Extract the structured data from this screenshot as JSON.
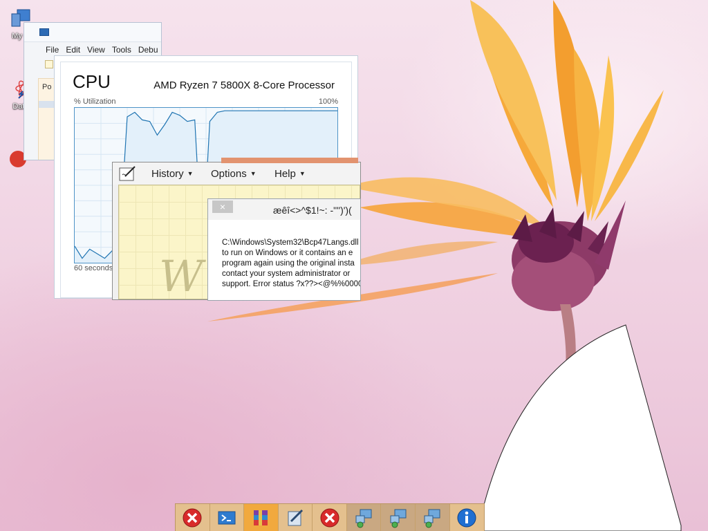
{
  "desktop": {
    "icons": [
      {
        "label": "My C"
      },
      {
        "label": "Data"
      }
    ]
  },
  "back_window": {
    "menu": [
      "File",
      "Edit",
      "View",
      "Tools",
      "Debu"
    ],
    "tab_label": "Po"
  },
  "cpu_window": {
    "title": "CPU",
    "model": "AMD Ryzen 7 5800X 8-Core Processor",
    "util_label": "% Utilization",
    "max_label": "100%",
    "time_label": "60 seconds",
    "utilization_series": [
      10,
      2,
      8,
      5,
      2,
      7,
      15,
      95,
      98,
      93,
      92,
      83,
      90,
      98,
      96,
      92,
      93,
      2,
      92,
      98,
      99,
      99,
      99,
      99,
      99,
      99,
      99,
      99,
      99,
      99,
      99,
      99,
      99,
      99,
      99,
      99
    ]
  },
  "note_window": {
    "menus": [
      {
        "label": "History"
      },
      {
        "label": "Options"
      },
      {
        "label": "Help"
      }
    ],
    "watermark": "W"
  },
  "error_dialog": {
    "close_symbol": "×",
    "title": "æêî<>^$1!~: -\"\")')(",
    "message": "C:\\Windows\\System32\\Bcp47Langs.dll\nto run on Windows or it contains an e\nprogram again using the original insta\ncontact your system administrator or \nsupport. Error status ?x??><@%%0000"
  },
  "taskbar": {
    "buttons": [
      {
        "name": "error-app-1",
        "icon": "error-icon"
      },
      {
        "name": "powershell",
        "icon": "powershell-icon"
      },
      {
        "name": "winrar",
        "icon": "archive-icon"
      },
      {
        "name": "notepad-app",
        "icon": "notepad-icon"
      },
      {
        "name": "error-app-2",
        "icon": "error-icon"
      },
      {
        "name": "network-app-1",
        "icon": "network-icon"
      },
      {
        "name": "network-app-2",
        "icon": "network-icon"
      },
      {
        "name": "network-app-3",
        "icon": "network-icon"
      },
      {
        "name": "info-app",
        "icon": "info-icon"
      }
    ]
  },
  "colors": {
    "taskbar": "#e4c08e",
    "taskbar_active": "#f1a93e",
    "cpu_line": "#1f74b2",
    "flower_petal": "#f7b13d",
    "flower_center": "#7a2b57"
  }
}
